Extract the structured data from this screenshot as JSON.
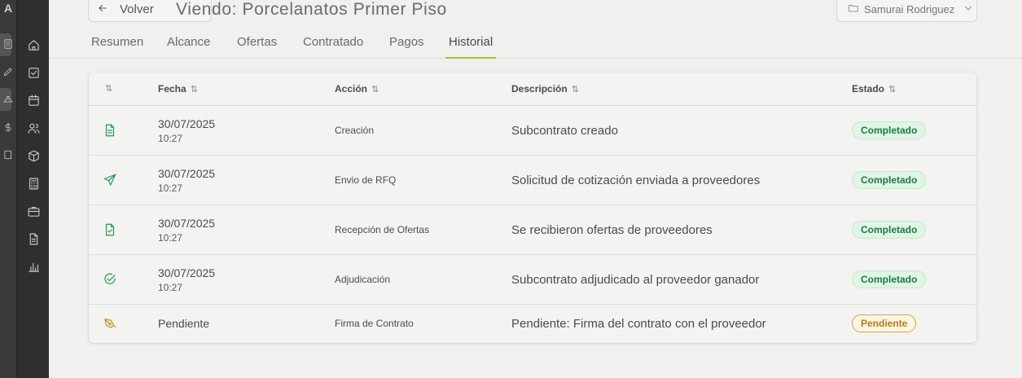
{
  "rail": {
    "logo_glyph": "A"
  },
  "nav_icons": [
    "building-icon",
    "home-icon",
    "checkbox-icon",
    "calendar-icon",
    "users-icon",
    "box-icon",
    "calculator-icon",
    "briefcase-icon",
    "file-icon",
    "bar-chart-icon"
  ],
  "header": {
    "back_label": "Volver",
    "title": "Viendo: Porcelanatos Primer Piso",
    "owner": "Samurai Rodriguez"
  },
  "tabs": [
    {
      "label": "Resumen"
    },
    {
      "label": "Alcance"
    },
    {
      "label": "Ofertas"
    },
    {
      "label": "Contratado"
    },
    {
      "label": "Pagos"
    },
    {
      "label": "Historial",
      "active": true
    }
  ],
  "table": {
    "columns": {
      "fecha": "Fecha",
      "accion": "Acción",
      "descripcion": "Descripción",
      "estado": "Estado"
    },
    "sort_glyph": "⇅",
    "rows": [
      {
        "icon": "document-icon",
        "date": "30/07/2025",
        "time": "10:27",
        "accion": "Creación",
        "descripcion": "Subcontrato creado",
        "estado": "Completado"
      },
      {
        "icon": "send-icon",
        "date": "30/07/2025",
        "time": "10:27",
        "accion": "Envio de RFQ",
        "descripcion": "Solicitud de cotización enviada a proveedores",
        "estado": "Completado"
      },
      {
        "icon": "file-check-icon",
        "date": "30/07/2025",
        "time": "10:27",
        "accion": "Recepción de Ofertas",
        "descripcion": "Se recibieron ofertas de proveedores",
        "estado": "Completado"
      },
      {
        "icon": "check-circle-icon",
        "date": "30/07/2025",
        "time": "10:27",
        "accion": "Adjudicación",
        "descripcion": "Subcontrato adjudicado al proveedor ganador",
        "estado": "Completado"
      },
      {
        "icon": "pen-icon",
        "date": "Pendiente",
        "time": "",
        "accion": "Firma de Contrato",
        "descripcion": "Pendiente: Firma del contrato con el proveedor",
        "estado": "Pendiente"
      }
    ]
  },
  "colors": {
    "accent": "#9bc33a",
    "success": "#1f9a55",
    "pending": "#c8901a"
  }
}
